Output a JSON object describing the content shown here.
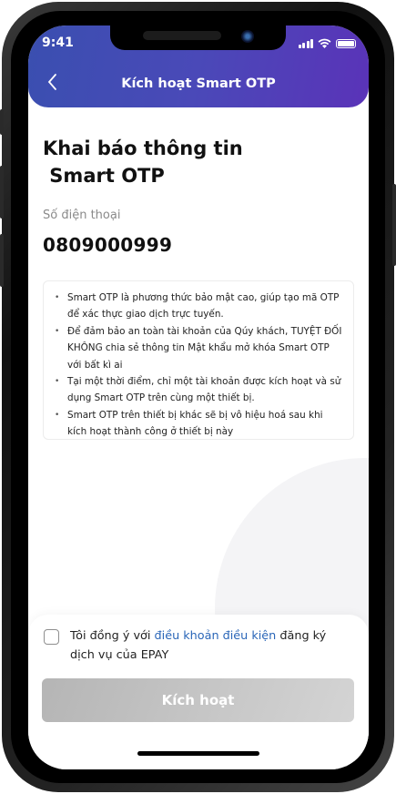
{
  "status_bar": {
    "time": "9:41"
  },
  "header": {
    "title": "Kích hoạt Smart OTP"
  },
  "main": {
    "title": "Khai báo thông tin\n Smart OTP",
    "phone_label": "Số điện thoại",
    "phone_value": "0809000999",
    "info_items": [
      "Smart OTP là phương thức bảo mật cao, giúp tạo mã OTP để xác thực giao dịch trực tuyến.",
      "Để đảm bảo an toàn tài khoản của Qúy khách, TUYỆT ĐỐI KHÔNG chia sẻ thông tin Mật khẩu mở khóa Smart OTP với bất kì ai",
      "Tại một thời điểm, chỉ một tài khoản được kích hoạt và sử dụng Smart OTP trên cùng một thiết bị.",
      "Smart OTP trên thiết bị khác sẽ bị vô hiệu hoá sau khi kích hoạt thành công ở thiết bị này"
    ]
  },
  "footer": {
    "agree_prefix": "Tôi đồng ý với ",
    "agree_link": "điều khoản điều kiện",
    "agree_suffix": " đăng ký dịch vụ của EPAY",
    "agree_checked": false,
    "activate_label": "Kích hoạt",
    "activate_enabled": false
  },
  "colors": {
    "header_start": "#3a4fb0",
    "header_end": "#5a33b8",
    "link": "#2a66b8",
    "button_disabled": "#c5c5c5"
  }
}
